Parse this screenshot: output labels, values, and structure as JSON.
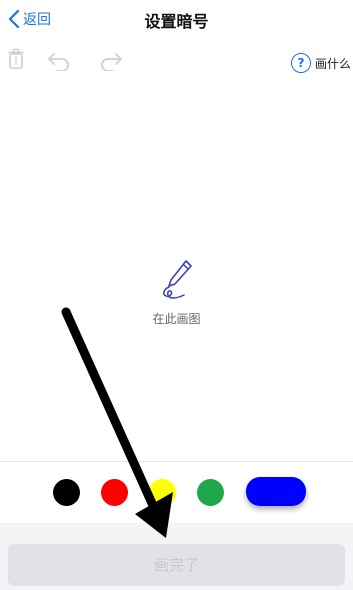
{
  "nav": {
    "back_label": "返回",
    "title": "设置暗号"
  },
  "toolbar": {
    "tools": [
      "trash-icon",
      "undo-icon",
      "redo-icon"
    ],
    "help_icon_text": "?",
    "help_label": "画什么"
  },
  "canvas": {
    "hint_icon": "pencil-icon",
    "hint_text": "在此画图"
  },
  "palette": {
    "colors": [
      {
        "name": "black",
        "hex": "#000000",
        "selected": false
      },
      {
        "name": "red",
        "hex": "#ff0000",
        "selected": false
      },
      {
        "name": "yellow",
        "hex": "#ffff00",
        "selected": false
      },
      {
        "name": "green",
        "hex": "#1fa84a",
        "selected": false
      },
      {
        "name": "blue",
        "hex": "#0000ff",
        "selected": true
      }
    ]
  },
  "footer": {
    "done_label": "画完了"
  }
}
